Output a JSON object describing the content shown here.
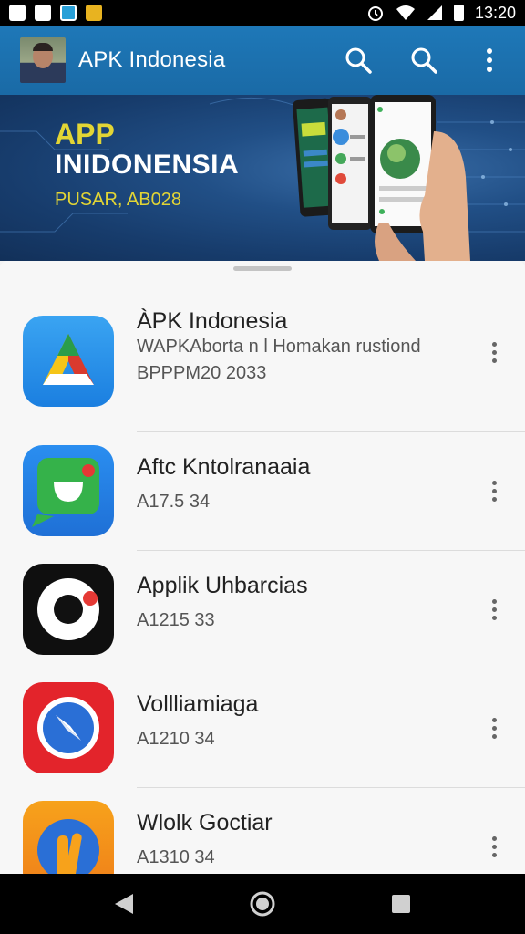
{
  "status_bar": {
    "time": "13:20",
    "left_icons": [
      "notification-icon",
      "mail-icon",
      "app-notification-icon",
      "game-notification-icon"
    ],
    "right_icons": [
      "alarm-icon",
      "wifi-icon",
      "signal-icon",
      "battery-icon"
    ]
  },
  "app_bar": {
    "title": "APK Indonesia",
    "actions": [
      "search-icon",
      "search-icon",
      "more-vert-icon"
    ],
    "color": "#1e78b8"
  },
  "banner": {
    "line1": "APP",
    "line2": "INIDONENSIA",
    "line3": "PUSAR, AB028",
    "accent": "#e2d535"
  },
  "apps": [
    {
      "name": "ÀPK Indonesia",
      "desc": "WAPKAborta n l Homakan rustiond",
      "version": "BPPPM20 2033",
      "icon": "apk-indonesia-icon"
    },
    {
      "name": "Aftc Kntolranaaia",
      "version": "A17.5 34",
      "icon": "chat-icon"
    },
    {
      "name": "Applik Uhbarcias",
      "version": "A1215 33",
      "icon": "ring-icon"
    },
    {
      "name": "Vollliamiaga",
      "version": "A1210 34",
      "icon": "compass-icon"
    },
    {
      "name": "Wlolk Goctiar",
      "version": "A1310 34",
      "icon": "hand-icon"
    }
  ],
  "nav": [
    "back-icon",
    "home-icon",
    "recents-icon"
  ]
}
